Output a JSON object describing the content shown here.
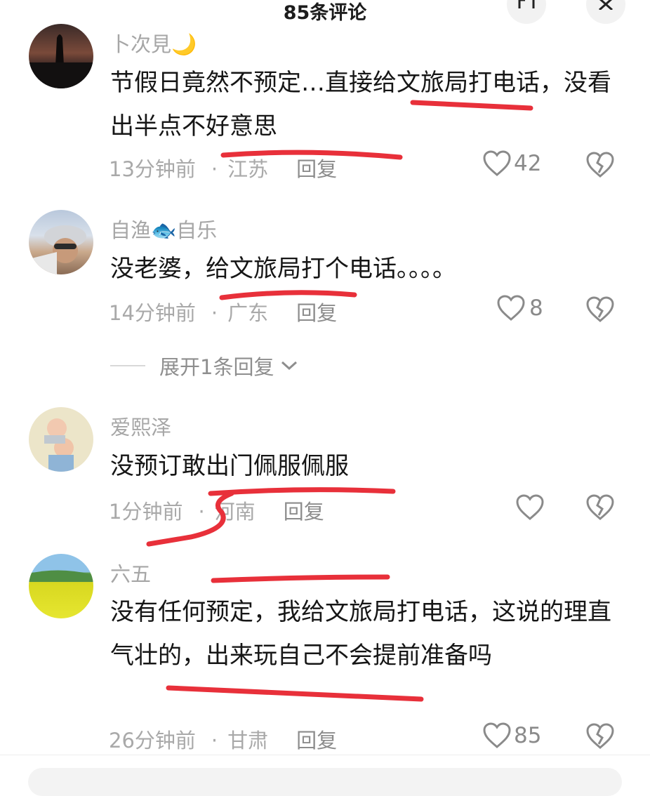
{
  "header": {
    "title": "85条评论"
  },
  "comments": [
    {
      "username": "卜次見🌙",
      "text": "节假日竟然不预定…直接给文旅局打电话，没看出半点不好意思",
      "time": "13分钟前",
      "location": "江苏",
      "reply": "回复",
      "likes": "42"
    },
    {
      "username": "自渔🐟自乐",
      "text": "没老婆，给文旅局打个电话。。。。",
      "time": "14分钟前",
      "location": "广东",
      "reply": "回复",
      "likes": "8",
      "expand": "展开1条回复"
    },
    {
      "username": "爱熙泽",
      "text": "没预订敢出门佩服佩服",
      "time": "1分钟前",
      "location": "河南",
      "reply": "回复",
      "likes": ""
    },
    {
      "username": "六五",
      "text": "没有任何预定，我给文旅局打电话，这说的理直气壮的，出来玩自己不会提前准备吗",
      "time": "26分钟前",
      "location": "甘肃",
      "reply": "回复",
      "likes": "85"
    }
  ],
  "colors": {
    "annotation": "#e8303a",
    "meta": "#a9a9a9"
  }
}
